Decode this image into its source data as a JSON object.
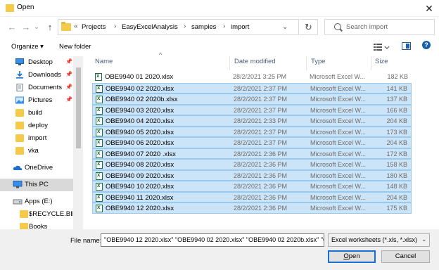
{
  "window": {
    "title": "Open",
    "close_symbol": "✕"
  },
  "navigation": {
    "back_symbol": "←",
    "forward_symbol": "→",
    "dropdown_symbol": "⌄",
    "up_symbol": "↑"
  },
  "address": {
    "overflow_symbol": "«",
    "crumbs": [
      "Projects",
      "EasyExcelAnalysis",
      "samples",
      "import"
    ],
    "separator": "›",
    "refresh_symbol": "↻"
  },
  "search": {
    "placeholder": "Search import"
  },
  "toolbar": {
    "organize_label": "Organize ▾",
    "new_folder_label": "New folder",
    "help_label": "?"
  },
  "nav_pane": {
    "pin_symbol": "📌",
    "items": [
      {
        "label": "Desktop",
        "icon": "desktop-icon",
        "pinned": true
      },
      {
        "label": "Downloads",
        "icon": "download-icon",
        "pinned": true
      },
      {
        "label": "Documents",
        "icon": "documents-icon",
        "pinned": true
      },
      {
        "label": "Pictures",
        "icon": "pictures-icon",
        "pinned": true
      },
      {
        "label": "build",
        "icon": "folder-icon",
        "pinned": false
      },
      {
        "label": "deploy",
        "icon": "folder-icon",
        "pinned": false
      },
      {
        "label": "import",
        "icon": "folder-icon",
        "pinned": false
      },
      {
        "label": "vka",
        "icon": "folder-icon",
        "pinned": false
      },
      {
        "label": "OneDrive",
        "icon": "onedrive-icon",
        "pinned": false
      },
      {
        "label": "This PC",
        "icon": "computer-icon",
        "pinned": false,
        "selected": true
      },
      {
        "label": "Apps (E:)",
        "icon": "drive-icon",
        "pinned": false
      },
      {
        "label": "$RECYCLE.BIN",
        "icon": "folder-icon",
        "pinned": false
      },
      {
        "label": "Books",
        "icon": "folder-icon",
        "pinned": false
      }
    ]
  },
  "columns": {
    "name": "Name",
    "date": "Date modified",
    "type": "Type",
    "size": "Size",
    "sort_caret": "^"
  },
  "files": [
    {
      "name": "OBE9940 01 2020.xlsx",
      "date": "28/2/2021 3:25 PM",
      "type": "Microsoft Excel W...",
      "size": "182 KB",
      "selected": false
    },
    {
      "name": "OBE9940 02 2020.xlsx",
      "date": "28/2/2021 2:37 PM",
      "type": "Microsoft Excel W...",
      "size": "141 KB",
      "selected": true
    },
    {
      "name": "OBE9940 02 2020b.xlsx",
      "date": "28/2/2021 2:37 PM",
      "type": "Microsoft Excel W...",
      "size": "137 KB",
      "selected": true
    },
    {
      "name": "OBE9940 03 2020.xlsx",
      "date": "28/2/2021 2:37 PM",
      "type": "Microsoft Excel W...",
      "size": "166 KB",
      "selected": true
    },
    {
      "name": "OBE9940 04 2020.xlsx",
      "date": "28/2/2021 2:33 PM",
      "type": "Microsoft Excel W...",
      "size": "204 KB",
      "selected": true
    },
    {
      "name": "OBE9940 05 2020.xlsx",
      "date": "28/2/2021 2:37 PM",
      "type": "Microsoft Excel W...",
      "size": "173 KB",
      "selected": true
    },
    {
      "name": "OBE9940 06 2020.xlsx",
      "date": "28/2/2021 2:37 PM",
      "type": "Microsoft Excel W...",
      "size": "204 KB",
      "selected": true
    },
    {
      "name": "OBE9940 07 2020 .xlsx",
      "date": "28/2/2021 2:36 PM",
      "type": "Microsoft Excel W...",
      "size": "172 KB",
      "selected": true
    },
    {
      "name": "OBE9940 08 2020.xlsx",
      "date": "28/2/2021 2:36 PM",
      "type": "Microsoft Excel W...",
      "size": "158 KB",
      "selected": true
    },
    {
      "name": "OBE9940 09 2020.xlsx",
      "date": "28/2/2021 2:36 PM",
      "type": "Microsoft Excel W...",
      "size": "180 KB",
      "selected": true
    },
    {
      "name": "OBE9940 10 2020.xlsx",
      "date": "28/2/2021 2:36 PM",
      "type": "Microsoft Excel W...",
      "size": "148 KB",
      "selected": true
    },
    {
      "name": "OBE9940 11 2020.xlsx",
      "date": "28/2/2021 2:36 PM",
      "type": "Microsoft Excel W...",
      "size": "204 KB",
      "selected": true
    },
    {
      "name": "OBE9940 12 2020.xlsx",
      "date": "28/2/2021 2:36 PM",
      "type": "Microsoft Excel W...",
      "size": "175 KB",
      "selected": true
    }
  ],
  "bottom": {
    "filename_label": "File name:",
    "filename_value": "\"OBE9940 12 2020.xlsx\" \"OBE9940 02 2020.xlsx\" \"OBE9940 02 2020b.xlsx\" \"C",
    "filetype_value": "Excel worksheets (*.xls, *.xlsx)",
    "chevron_symbol": "⌄",
    "open_label": "Open",
    "cancel_label": "Cancel"
  },
  "colors": {
    "selection_bg": "#cce4f7",
    "selection_border": "#99c9ef",
    "accent": "#1a6fcf",
    "folder": "#f5c94a",
    "excel_green": "#1d6f42"
  }
}
